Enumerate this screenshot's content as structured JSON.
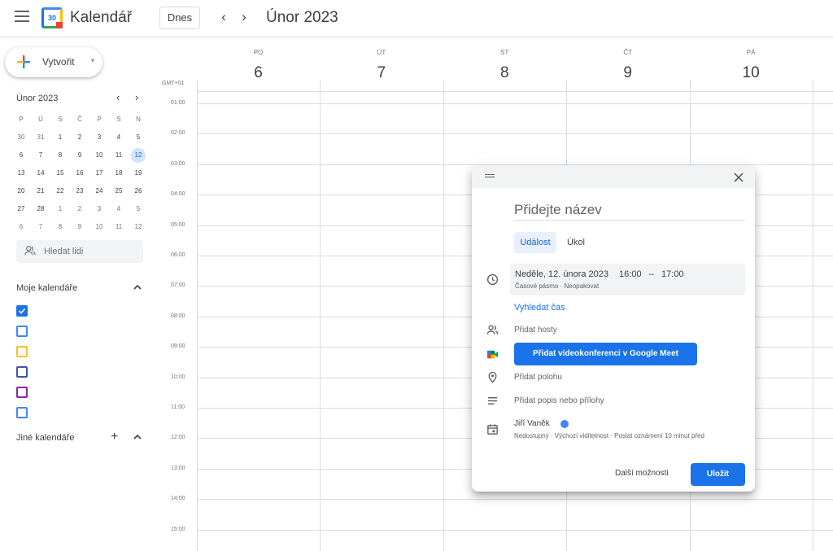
{
  "header": {
    "app_title": "Kalendář",
    "logo_day": "30",
    "today_label": "Dnes",
    "prev_icon": "‹",
    "next_icon": "›",
    "month_title": "Únor 2023"
  },
  "sidebar": {
    "create_label": "Vytvořit",
    "mini": {
      "title": "Únor 2023",
      "weekdays": [
        "P",
        "Ú",
        "S",
        "Č",
        "P",
        "S",
        "N"
      ],
      "weeks": [
        [
          "30",
          "31",
          "1",
          "2",
          "3",
          "4",
          "5"
        ],
        [
          "6",
          "7",
          "8",
          "9",
          "10",
          "11",
          "12"
        ],
        [
          "13",
          "14",
          "15",
          "16",
          "17",
          "18",
          "19"
        ],
        [
          "20",
          "21",
          "22",
          "23",
          "24",
          "25",
          "26"
        ],
        [
          "27",
          "28",
          "1",
          "2",
          "3",
          "4",
          "5"
        ],
        [
          "6",
          "7",
          "8",
          "9",
          "10",
          "11",
          "12"
        ]
      ],
      "selected_day": "12"
    },
    "people_placeholder": "Hledat lidi",
    "my_calendars_title": "Moje kalendáře",
    "calendar_colors": [
      "#1a73e8",
      "#4285f4",
      "#f6bf26",
      "#3f51b5",
      "#8e24aa",
      "#4285f4"
    ],
    "other_calendars_title": "Jiné kalendáře"
  },
  "week": {
    "timezone": "GMT+01",
    "days": [
      {
        "name": "PO",
        "num": "6"
      },
      {
        "name": "ÚT",
        "num": "7"
      },
      {
        "name": "ST",
        "num": "8"
      },
      {
        "name": "ČT",
        "num": "9"
      },
      {
        "name": "PÁ",
        "num": "10"
      }
    ],
    "hours": [
      "01:00",
      "02:00",
      "03:00",
      "04:00",
      "05:00",
      "06:00",
      "07:00",
      "08:00",
      "09:00",
      "10:00",
      "11:00",
      "12:00",
      "13:00",
      "14:00",
      "15:00"
    ]
  },
  "dialog": {
    "title_placeholder": "Přidejte název",
    "tab_event": "Událost",
    "tab_task": "Úkol",
    "date_text": "Neděle, 12. února 2023",
    "time_text": "16:00   –   17:00",
    "time_sub": "Časové pásmo · Neopakovat",
    "find_time": "Vyhledat čas",
    "add_guests": "Přidat hosty",
    "meet_button": "Přidat videokonferenci v Google Meet",
    "add_location": "Přidat polohu",
    "add_description": "Přidat popis nebo přílohy",
    "owner_name": "Jiří Vaněk",
    "owner_sub": "Nedostupný · Výchozí viditelnost · Poslat oznámení 10 minut před",
    "more_options": "Další možnosti",
    "save": "Uložit"
  }
}
